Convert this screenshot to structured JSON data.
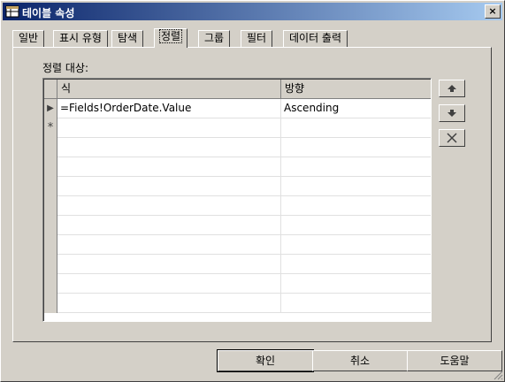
{
  "window": {
    "title": "테이블 속성",
    "close_label": "×"
  },
  "tabs": [
    {
      "label": "일반"
    },
    {
      "label": "표시 유형"
    },
    {
      "label": "탐색"
    },
    {
      "label": "정렬"
    },
    {
      "label": "그룹"
    },
    {
      "label": "필터"
    },
    {
      "label": "데이터 출력"
    }
  ],
  "active_tab": "정렬",
  "sort": {
    "section_label": "정렬 대상:",
    "columns": [
      "식",
      "방향"
    ],
    "rows": [
      {
        "marker": "▶",
        "expression": "=Fields!OrderDate.Value",
        "direction": "Ascending"
      },
      {
        "marker": "*",
        "expression": "",
        "direction": ""
      }
    ]
  },
  "side_buttons": {
    "up": "move-up-icon",
    "down": "move-down-icon",
    "delete": "delete-icon"
  },
  "footer": {
    "ok": "확인",
    "cancel": "취소",
    "help": "도움말"
  }
}
